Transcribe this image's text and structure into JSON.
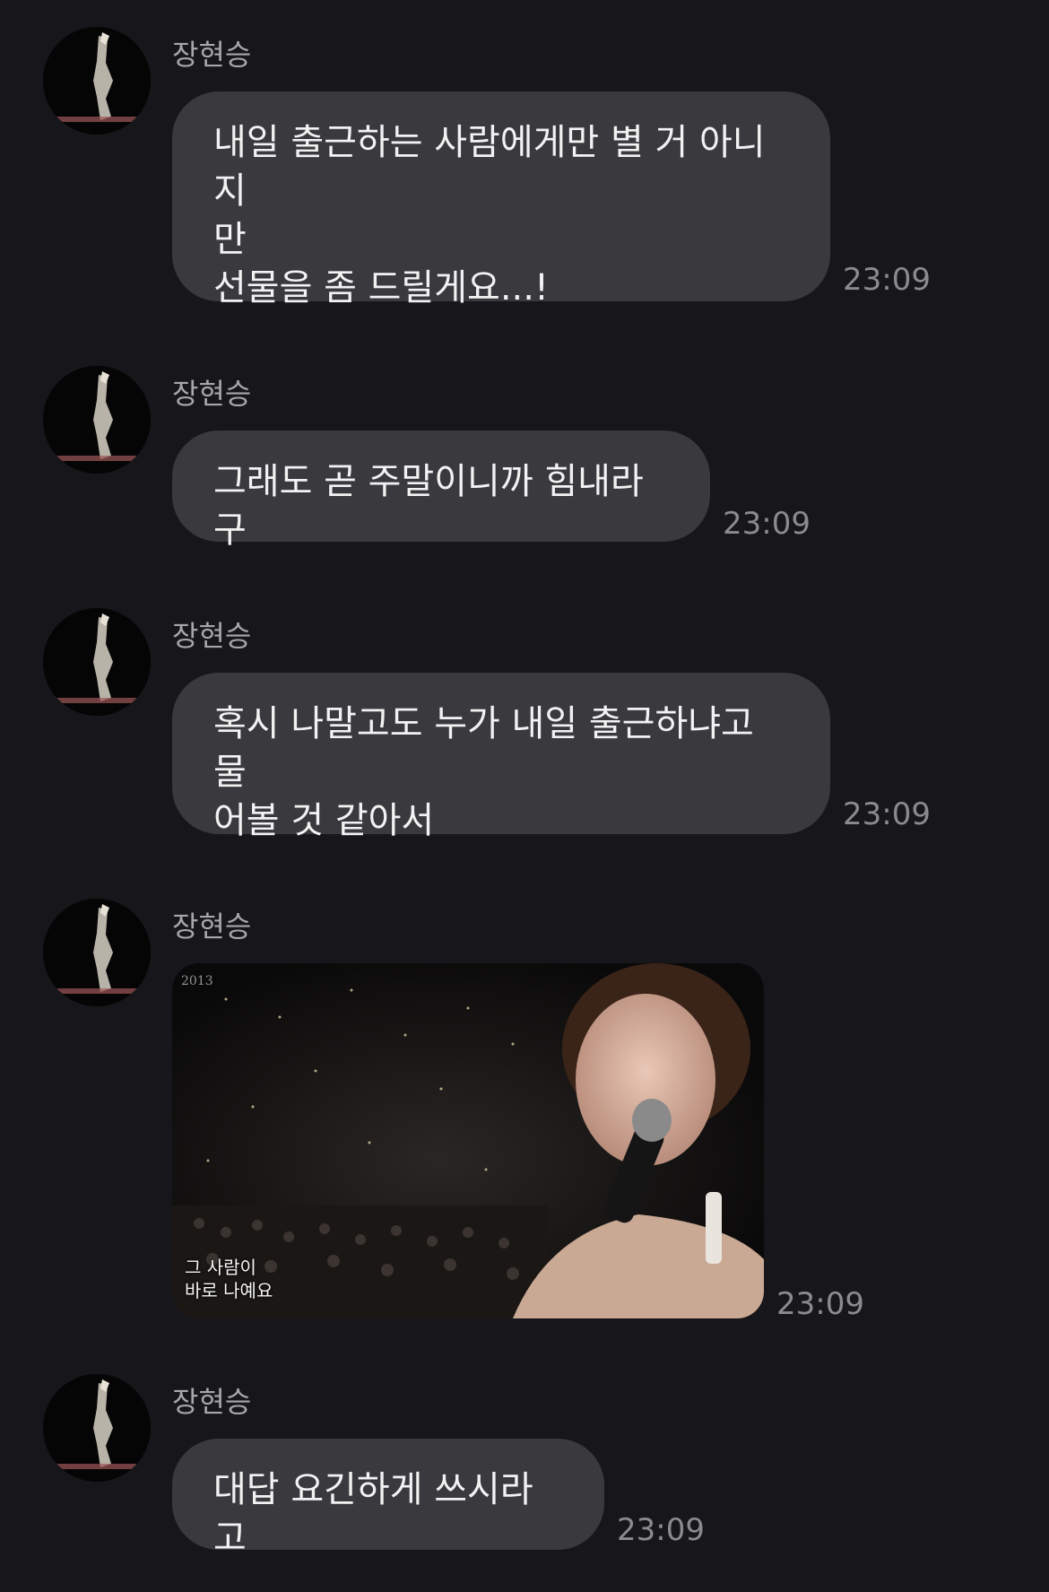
{
  "sender_name": "장현승",
  "messages": [
    {
      "text": "내일 출근하는 사람에게만 별 거 아니지\n만\n선물을 좀 드릴게요...!",
      "time": "23:09"
    },
    {
      "text": "그래도 곧 주말이니까 힘내라구",
      "time": "23:09"
    },
    {
      "text": "혹시 나말고도 누가 내일 출근하냐고 물\n어볼 것 같아서",
      "time": "23:09"
    },
    {
      "photo_caption": "그 사람이\n바로 나예요",
      "photo_logo": "2013 ",
      "time": "23:09"
    },
    {
      "text": "대답 요긴하게 쓰시라고",
      "time": "23:09"
    }
  ]
}
